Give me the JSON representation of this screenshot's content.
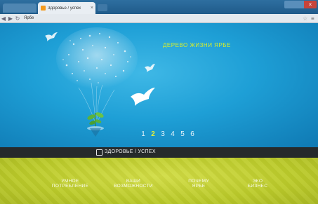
{
  "browser": {
    "tab_title": "Здоровье / успех",
    "url": "Ярбе",
    "close_glyph": "×",
    "back_glyph": "◀",
    "forward_glyph": "▶",
    "reload_glyph": "↻",
    "star_glyph": "☆",
    "menu_glyph": "≡"
  },
  "hero": {
    "headline": "ДЕРЕВО ЖИЗНИ ЯРБЕ"
  },
  "pager": {
    "pages": [
      "1",
      "2",
      "3",
      "4",
      "5",
      "6"
    ],
    "active": "2"
  },
  "navbar": {
    "title": "ЗДОРОВЬЕ / УСПЕХ"
  },
  "bottom_nav": {
    "items": [
      {
        "line1": "УМНОЕ",
        "line2": "ПОТРЕБЛЕНИЕ"
      },
      {
        "line1": "ВАШИ",
        "line2": "ВОЗМОЖНОСТИ"
      },
      {
        "line1": "ПОЧЕМУ",
        "line2": "ЯРБЕ"
      },
      {
        "line1": "ЭКО",
        "line2": "БИЗНЕС"
      }
    ]
  },
  "colors": {
    "accent": "#d7ef2a",
    "hero_blue": "#1e9fd6",
    "navbar": "#262a2b",
    "bottom_green": "#c9d63a"
  }
}
